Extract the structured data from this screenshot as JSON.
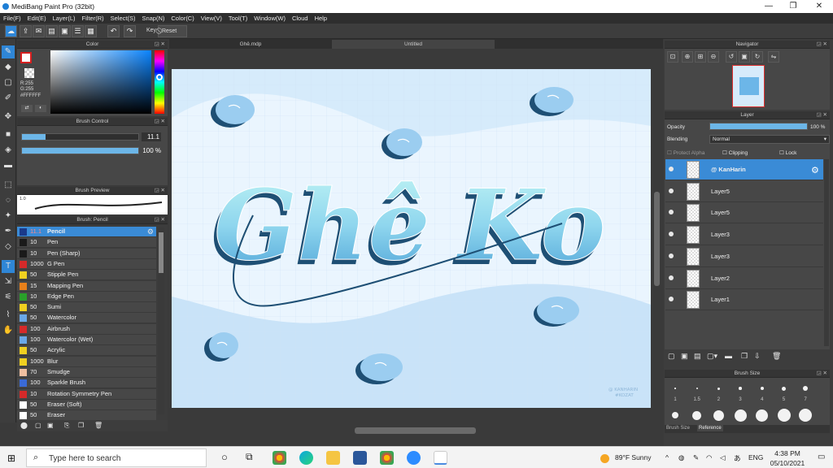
{
  "window": {
    "title": "MediBang Paint Pro (32bit)",
    "min": "—",
    "max": "❐",
    "close": "✕"
  },
  "menu": [
    "File(F)",
    "Edit(E)",
    "Layer(L)",
    "Filter(R)",
    "Select(S)",
    "Snap(N)",
    "Color(C)",
    "View(V)",
    "Tool(T)",
    "Window(W)",
    "Cloud",
    "Help"
  ],
  "toolbar": {
    "key_label": "Key",
    "reset_label": "Reset"
  },
  "color_panel": {
    "title": "Color",
    "r": "R:255",
    "g": "G:255",
    "hex": "#FFFFFF",
    "accent": "#0a84ff"
  },
  "brush_control": {
    "title": "Brush Control",
    "size_value": "11.1",
    "size_fraction": 0.2,
    "opacity_value": "100 %",
    "opacity_fraction": 1.0
  },
  "brush_preview": {
    "title": "Brush Preview",
    "size": "1.0"
  },
  "brush_list": {
    "title": "Brush: Pencil",
    "items": [
      {
        "size": "11.1",
        "name": "Pencil",
        "color": "#1a3a8a",
        "selected": true
      },
      {
        "size": "10",
        "name": "Pen",
        "color": "#1a1a1a"
      },
      {
        "size": "10",
        "name": "Pen (Sharp)",
        "color": "#1a1a1a"
      },
      {
        "size": "1000",
        "name": "G Pen",
        "color": "#d62a2a"
      },
      {
        "size": "50",
        "name": "Stipple Pen",
        "color": "#f0d020"
      },
      {
        "size": "15",
        "name": "Mapping Pen",
        "color": "#e8801a"
      },
      {
        "size": "10",
        "name": "Edge Pen",
        "color": "#2aa02a"
      },
      {
        "size": "50",
        "name": "Sumi",
        "color": "#f0d020"
      },
      {
        "size": "50",
        "name": "Watercolor",
        "color": "#6aa8e8"
      },
      {
        "size": "100",
        "name": "Airbrush",
        "color": "#d62a2a"
      },
      {
        "size": "100",
        "name": "Watercolor (Wet)",
        "color": "#6aa8e8"
      },
      {
        "size": "50",
        "name": "Acrylic",
        "color": "#f0d020"
      },
      {
        "size": "1000",
        "name": "Blur",
        "color": "#f0d020"
      },
      {
        "size": "70",
        "name": "Smudge",
        "color": "#f0c0a0"
      },
      {
        "size": "100",
        "name": "Sparkle Brush",
        "color": "#3a6ad6"
      },
      {
        "size": "10",
        "name": "Rotation Symmetry Pen",
        "color": "#d62a2a"
      },
      {
        "size": "50",
        "name": "Eraser (Soft)",
        "color": "#ffffff"
      },
      {
        "size": "50",
        "name": "Eraser",
        "color": "#ffffff"
      }
    ]
  },
  "documents": {
    "tabs": [
      "Ghê.mdp",
      "Untitled"
    ]
  },
  "artwork": {
    "text_left": "Ghê",
    "text_right": "Ko",
    "watermark_1": "@ KANHARIN",
    "watermark_2": "#KOZAT"
  },
  "navigator": {
    "title": "Navigator"
  },
  "layer_panel": {
    "title": "Layer",
    "opacity_label": "Opacity",
    "opacity_value": "100 %",
    "blending_label": "Blending",
    "blending_value": "Normal",
    "protect_alpha": "Protect Alpha",
    "clipping": "Clipping",
    "lock": "Lock",
    "layers": [
      {
        "name": "@ KanHarin",
        "selected": true
      },
      {
        "name": "Layer5"
      },
      {
        "name": "Layer5"
      },
      {
        "name": "Layer3"
      },
      {
        "name": "Layer3"
      },
      {
        "name": "Layer2"
      },
      {
        "name": "Layer1"
      }
    ]
  },
  "brush_size": {
    "title": "Brush Size",
    "labels": [
      "1",
      "1.5",
      "2",
      "3",
      "4",
      "5",
      "7"
    ],
    "tabs": [
      "Brush Size",
      "Reference"
    ]
  },
  "taskbar": {
    "search_placeholder": "Type here to search",
    "weather": "89°F  Sunny",
    "lang": "ENG",
    "time": "4:38 PM",
    "date": "05/10/2021"
  }
}
